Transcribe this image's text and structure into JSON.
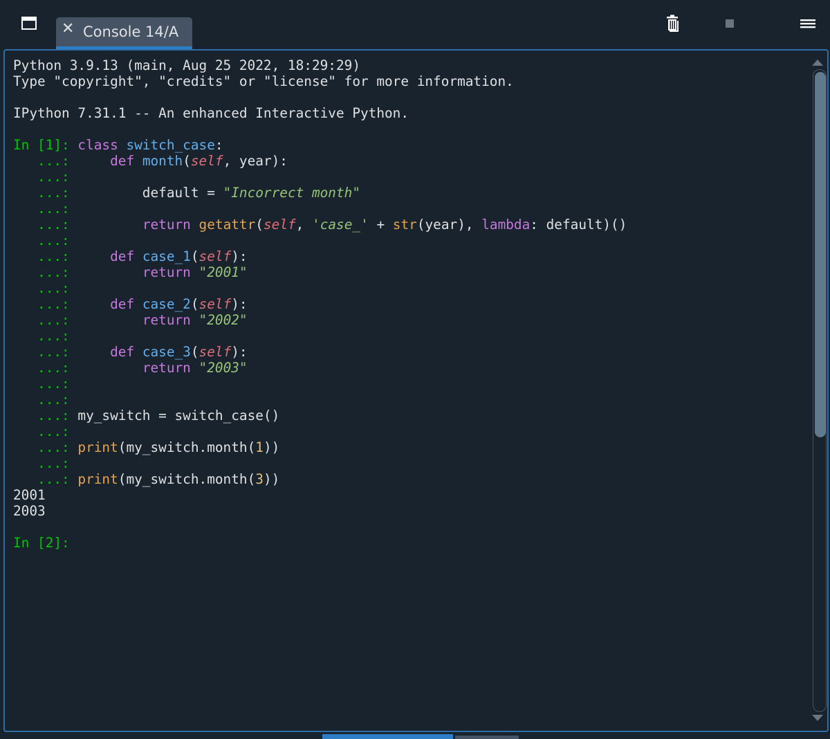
{
  "tab": {
    "close_glyph": "✕",
    "label": "Console 14/A"
  },
  "toolbar": {
    "window_icon": "window-icon",
    "clear_icon": "trash-icon",
    "stop_icon": "stop-icon",
    "menu_icon": "hamburger-menu-icon"
  },
  "colors": {
    "background": "#19232d",
    "tab_active": "#455364",
    "accent": "#2e7dc7",
    "prompt": "#00c800",
    "keyword": "#c678dd",
    "function_name": "#61afef",
    "builtin": "#e5a450",
    "self": "#e06c75",
    "string": "#98c379",
    "number": "#e5c07b"
  },
  "console": {
    "lines": [
      [
        {
          "t": "Python 3.9.13 (main, Aug 25 2022, 18:29:29)"
        }
      ],
      [
        {
          "t": "Type \"copyright\", \"credits\" or \"license\" for more information."
        }
      ],
      [],
      [
        {
          "t": "IPython 7.31.1 -- An enhanced Interactive Python."
        }
      ],
      [],
      [
        {
          "t": "In [1]: ",
          "c": "p-in"
        },
        {
          "t": "class ",
          "c": "kw"
        },
        {
          "t": "switch_case",
          "c": "fn"
        },
        {
          "t": ":"
        }
      ],
      [
        {
          "t": "   ...: ",
          "c": "p-cont"
        },
        {
          "t": "    "
        },
        {
          "t": "def ",
          "c": "kw"
        },
        {
          "t": "month",
          "c": "fn"
        },
        {
          "t": "("
        },
        {
          "t": "self",
          "c": "self"
        },
        {
          "t": ", year):"
        }
      ],
      [
        {
          "t": "   ...:",
          "c": "p-cont"
        }
      ],
      [
        {
          "t": "   ...: ",
          "c": "p-cont"
        },
        {
          "t": "        default = "
        },
        {
          "t": "\"Incorrect month\"",
          "c": "str"
        }
      ],
      [
        {
          "t": "   ...:",
          "c": "p-cont"
        }
      ],
      [
        {
          "t": "   ...: ",
          "c": "p-cont"
        },
        {
          "t": "        "
        },
        {
          "t": "return ",
          "c": "kw"
        },
        {
          "t": "getattr",
          "c": "bi"
        },
        {
          "t": "("
        },
        {
          "t": "self",
          "c": "self"
        },
        {
          "t": ", "
        },
        {
          "t": "'case_'",
          "c": "str"
        },
        {
          "t": " + "
        },
        {
          "t": "str",
          "c": "bi"
        },
        {
          "t": "(year), "
        },
        {
          "t": "lambda",
          "c": "kw"
        },
        {
          "t": ": default)()"
        }
      ],
      [
        {
          "t": "   ...:",
          "c": "p-cont"
        }
      ],
      [
        {
          "t": "   ...: ",
          "c": "p-cont"
        },
        {
          "t": "    "
        },
        {
          "t": "def ",
          "c": "kw"
        },
        {
          "t": "case_1",
          "c": "fn"
        },
        {
          "t": "("
        },
        {
          "t": "self",
          "c": "self"
        },
        {
          "t": "):"
        }
      ],
      [
        {
          "t": "   ...: ",
          "c": "p-cont"
        },
        {
          "t": "        "
        },
        {
          "t": "return ",
          "c": "kw"
        },
        {
          "t": "\"2001\"",
          "c": "str"
        }
      ],
      [
        {
          "t": "   ...:",
          "c": "p-cont"
        }
      ],
      [
        {
          "t": "   ...: ",
          "c": "p-cont"
        },
        {
          "t": "    "
        },
        {
          "t": "def ",
          "c": "kw"
        },
        {
          "t": "case_2",
          "c": "fn"
        },
        {
          "t": "("
        },
        {
          "t": "self",
          "c": "self"
        },
        {
          "t": "):"
        }
      ],
      [
        {
          "t": "   ...: ",
          "c": "p-cont"
        },
        {
          "t": "        "
        },
        {
          "t": "return ",
          "c": "kw"
        },
        {
          "t": "\"2002\"",
          "c": "str"
        }
      ],
      [
        {
          "t": "   ...:",
          "c": "p-cont"
        }
      ],
      [
        {
          "t": "   ...: ",
          "c": "p-cont"
        },
        {
          "t": "    "
        },
        {
          "t": "def ",
          "c": "kw"
        },
        {
          "t": "case_3",
          "c": "fn"
        },
        {
          "t": "("
        },
        {
          "t": "self",
          "c": "self"
        },
        {
          "t": "):"
        }
      ],
      [
        {
          "t": "   ...: ",
          "c": "p-cont"
        },
        {
          "t": "        "
        },
        {
          "t": "return ",
          "c": "kw"
        },
        {
          "t": "\"2003\"",
          "c": "str"
        }
      ],
      [
        {
          "t": "   ...:",
          "c": "p-cont"
        }
      ],
      [
        {
          "t": "   ...:",
          "c": "p-cont"
        }
      ],
      [
        {
          "t": "   ...: ",
          "c": "p-cont"
        },
        {
          "t": "my_switch = switch_case()"
        }
      ],
      [
        {
          "t": "   ...:",
          "c": "p-cont"
        }
      ],
      [
        {
          "t": "   ...: ",
          "c": "p-cont"
        },
        {
          "t": "print",
          "c": "bi"
        },
        {
          "t": "(my_switch.month("
        },
        {
          "t": "1",
          "c": "num"
        },
        {
          "t": "))"
        }
      ],
      [
        {
          "t": "   ...:",
          "c": "p-cont"
        }
      ],
      [
        {
          "t": "   ...: ",
          "c": "p-cont"
        },
        {
          "t": "print",
          "c": "bi"
        },
        {
          "t": "(my_switch.month("
        },
        {
          "t": "3",
          "c": "num"
        },
        {
          "t": "))"
        }
      ],
      [
        {
          "t": "2001"
        }
      ],
      [
        {
          "t": "2003"
        }
      ],
      [],
      [
        {
          "t": "In [2]: ",
          "c": "p-in"
        }
      ]
    ]
  }
}
